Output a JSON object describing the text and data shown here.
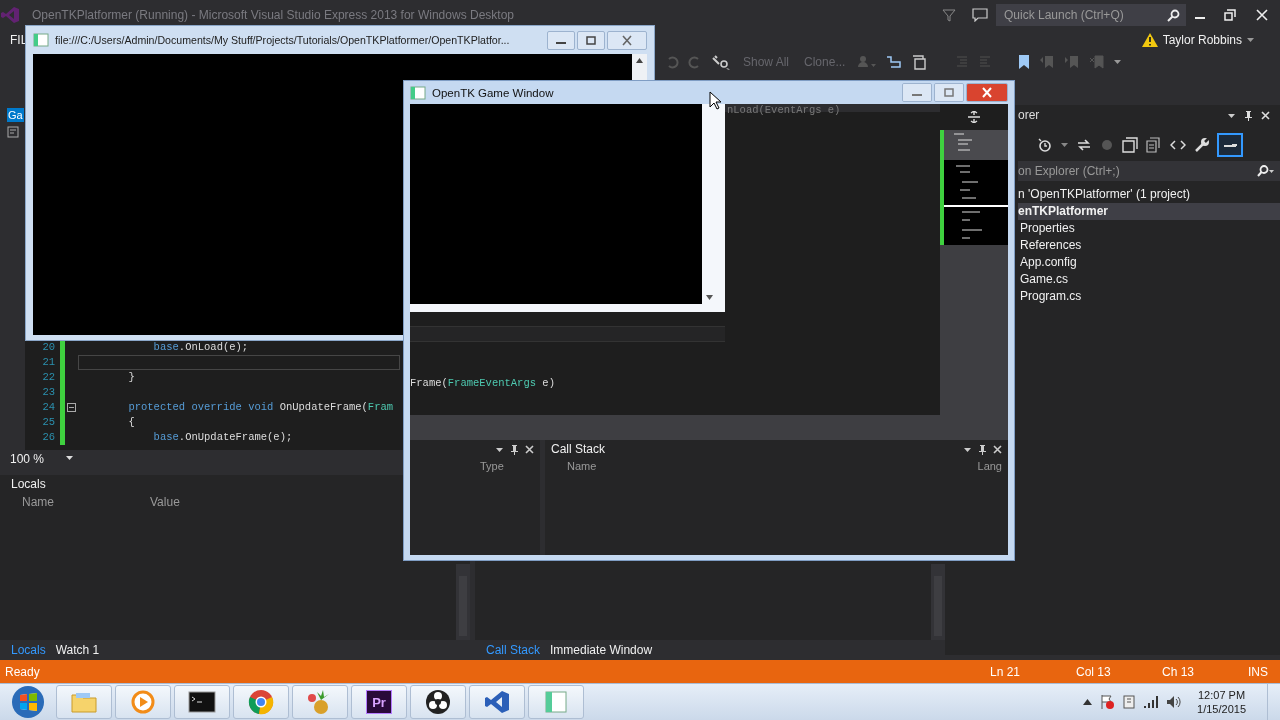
{
  "ide": {
    "title": "OpenTKPlatformer (Running) - Microsoft Visual Studio Express 2013 for Windows Desktop",
    "quick_launch": {
      "placeholder": "Quick Launch (Ctrl+Q)"
    },
    "menu": [
      "FIL"
    ],
    "user": "Taylor Robbins",
    "toolbar": [
      {
        "label": "Show All",
        "disabled": true
      },
      {
        "label": "Clone...",
        "disabled": true
      }
    ],
    "document_tab": {
      "label": "Ga",
      "selected": true
    }
  },
  "editor": {
    "lines": [
      {
        "number": "20",
        "current": false,
        "foldable": false,
        "tokens": [
          {
            "kind": "keyword",
            "text": "            base"
          },
          {
            "kind": "plain",
            "text": ".OnLoad(e);"
          }
        ]
      },
      {
        "number": "21",
        "current": true,
        "foldable": false
      },
      {
        "number": "22",
        "current": false,
        "foldable": false,
        "tokens": [
          {
            "kind": "plain",
            "text": "        }"
          }
        ]
      },
      {
        "number": "23",
        "current": false,
        "foldable": false
      },
      {
        "number": "24",
        "current": false,
        "foldable": true,
        "tokens": [
          {
            "kind": "keyword",
            "text": "        protected override void"
          },
          {
            "kind": "plain",
            "text": " OnUpdateFrame("
          },
          {
            "kind": "type",
            "text": "Fram"
          }
        ]
      },
      {
        "number": "25",
        "current": false,
        "foldable": false,
        "tokens": [
          {
            "kind": "plain",
            "text": "        {"
          }
        ]
      },
      {
        "number": "26",
        "current": false,
        "foldable": false,
        "tokens": [
          {
            "kind": "keyword",
            "text": "            base"
          },
          {
            "kind": "plain",
            "text": ".OnUpdateFrame(e);"
          }
        ]
      }
    ],
    "zoom": "100 %"
  },
  "locals": {
    "title": "Locals",
    "columns": [
      "Name",
      "Value"
    ]
  },
  "locals_tabs": [
    {
      "label": "Locals",
      "selected": true
    },
    {
      "label": "Watch 1",
      "selected": false
    }
  ],
  "output_tabs": [
    {
      "label": "Call Stack",
      "selected": true
    },
    {
      "label": "Immediate Window",
      "selected": false
    }
  ],
  "solution_explorer": {
    "title": "orer",
    "search": {
      "placeholder": "on Explorer (Ctrl+;)"
    },
    "tree": [
      {
        "label": "n 'OpenTKPlatformer' (1 project)",
        "kind": "solution",
        "selected": false,
        "children": [
          {
            "label": "enTKPlatformer",
            "kind": "project",
            "selected": true,
            "children": [
              {
                "label": "Properties",
                "kind": "item",
                "selected": false
              },
              {
                "label": "References",
                "kind": "item",
                "selected": false
              },
              {
                "label": "App.config",
                "kind": "item",
                "selected": false
              },
              {
                "label": "Game.cs",
                "kind": "item",
                "selected": false
              },
              {
                "label": "Program.cs",
                "kind": "item",
                "selected": false
              }
            ]
          }
        ]
      }
    ]
  },
  "status_bar": {
    "message": "Ready",
    "line": "Ln 21",
    "column": "Col 13",
    "char": "Ch 13",
    "mode": "INS"
  },
  "console_window": {
    "title": "file:///C:/Users/Admin/Documents/My Stuff/Projects/Tutorials/OpenTKPlatformer/OpenTKPlatfor..."
  },
  "game_window": {
    "title": "OpenTK Game Window",
    "behind": {
      "top_code": "nLoad(EventArgs e)",
      "code_tokens": [
        {
          "kind": "plain",
          "text": "Frame("
        },
        {
          "kind": "type",
          "text": "FrameEventArgs"
        },
        {
          "kind": "plain",
          "text": " e)"
        }
      ],
      "left_panel_column": "Type",
      "right_panel": {
        "title": "Call Stack",
        "columns": [
          "Name",
          "Lang"
        ]
      }
    }
  },
  "taskbar": {
    "apps": [
      {
        "kind": "explorer"
      },
      {
        "kind": "media"
      },
      {
        "kind": "console"
      },
      {
        "kind": "chrome"
      },
      {
        "kind": "paint"
      },
      {
        "kind": "premiere",
        "label": "Pr"
      },
      {
        "kind": "obs"
      },
      {
        "kind": "vs"
      },
      {
        "kind": "window"
      }
    ],
    "time": "12:07 PM",
    "date": "1/15/2015"
  }
}
